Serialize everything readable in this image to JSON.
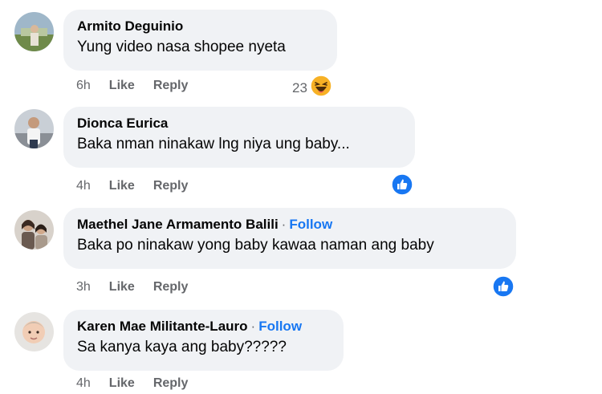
{
  "comments": [
    {
      "name": "Armito Deguinio",
      "follow": "",
      "text": "Yung video nasa shopee nyeta",
      "time": "6h",
      "like": "Like",
      "reply": "Reply",
      "reaction_count": "23",
      "reaction_icon": "haha-emoji-icon"
    },
    {
      "name": "Dionca Eurica",
      "follow": "",
      "text": "Baka nman ninakaw lng niya ung baby...",
      "time": "4h",
      "like": "Like",
      "reply": "Reply",
      "reaction_icon": "like-reaction-icon"
    },
    {
      "name": "Maethel Jane Armamento Balili",
      "follow": "Follow",
      "text": "Baka po ninakaw yong baby kawaa naman ang baby",
      "time": "3h",
      "like": "Like",
      "reply": "Reply",
      "reaction_icon": "like-reaction-icon"
    },
    {
      "name": "Karen Mae Militante-Lauro",
      "follow": "Follow",
      "text": "Sa kanya kaya ang baby?????",
      "time": "4h",
      "like": "Like",
      "reply": "Reply"
    }
  ],
  "separator": "·",
  "colors": {
    "bubble": "#f0f2f5",
    "follow": "#1877f2",
    "muted": "#65676b",
    "text": "#050505"
  }
}
